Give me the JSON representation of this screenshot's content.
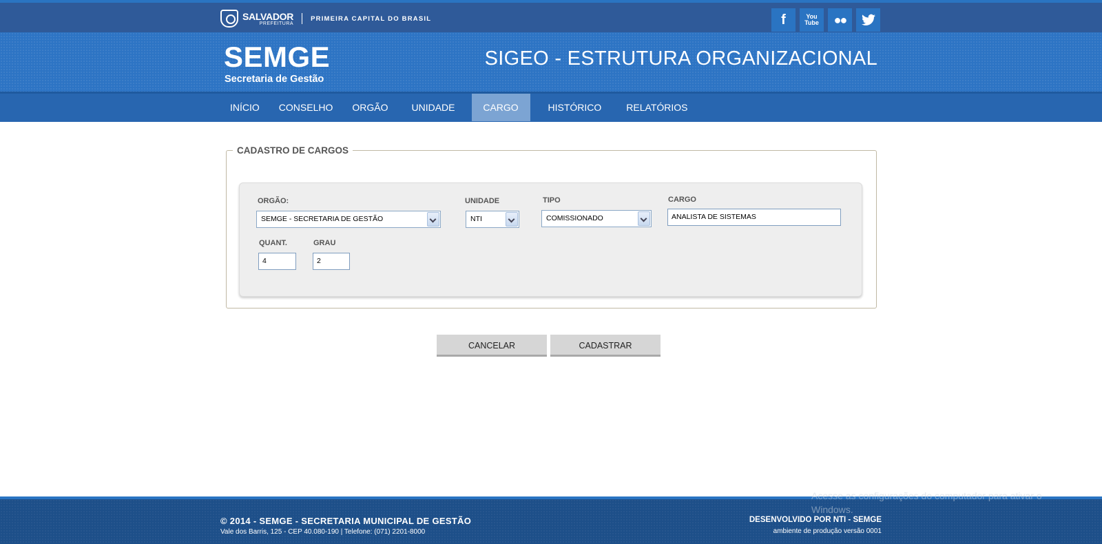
{
  "topbar": {
    "logo_main": "SALVADOR",
    "logo_sub": "PREFEITURA",
    "tagline": "PRIMEIRA CAPITAL DO BRASIL",
    "social": {
      "facebook": "f",
      "youtube_1": "You",
      "youtube_2": "Tube",
      "flickr": "●●"
    }
  },
  "header": {
    "brand": "SEMGE",
    "brand_sub": "Secretaria de Gestão",
    "app_title": "SIGEO - ESTRUTURA ORGANIZACIONAL"
  },
  "nav": {
    "items": [
      {
        "label": "INÍCIO"
      },
      {
        "label": "CONSELHO"
      },
      {
        "label": "ORGÃO"
      },
      {
        "label": "UNIDADE"
      },
      {
        "label": "CARGO"
      },
      {
        "label": "HISTÓRICO"
      },
      {
        "label": "RELATÓRIOS"
      }
    ],
    "active": "CARGO"
  },
  "form": {
    "legend": "CADASTRO DE CARGOS",
    "orgao": {
      "label": "ORGÃO:",
      "value": "SEMGE - SECRETARIA DE GESTÃO"
    },
    "unidade": {
      "label": "UNIDADE",
      "value": "NTI"
    },
    "tipo": {
      "label": "TIPO",
      "value": "COMISSIONADO"
    },
    "cargo": {
      "label": "CARGO",
      "value": "ANALISTA DE SISTEMAS"
    },
    "quant": {
      "label": "QUANT.",
      "value": "4"
    },
    "grau": {
      "label": "GRAU",
      "value": "2"
    }
  },
  "actions": {
    "cancel": "CANCELAR",
    "submit": "CADASTRAR"
  },
  "footer": {
    "copyright": "© 2014 - SEMGE - SECRETARIA MUNICIPAL DE GESTÃO",
    "address": "Vale dos Barris, 125 - CEP 40.080-190 | Telefone: (071) 2201-8000",
    "dev": "DESENVOLVIDO POR NTI - SEMGE",
    "env": "ambiente de produção versão 0001"
  },
  "watermark": {
    "line1": "Acesse as configurações do computador para ativar o",
    "line2": "Windows."
  },
  "colors": {
    "topbar": "#2f5a99",
    "header": "#2d74c4",
    "nav": "#2866b0",
    "nav_active": "#7ca4d3",
    "footer": "#1d4f89"
  }
}
